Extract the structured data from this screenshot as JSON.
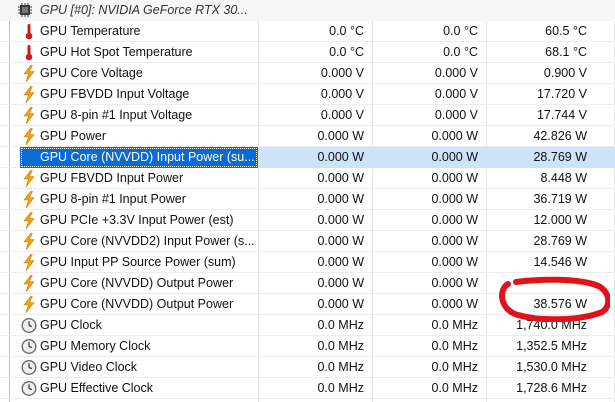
{
  "group": {
    "label": "GPU [#0]: NVIDIA GeForce RTX 30...",
    "icon": "gpu-chip-icon"
  },
  "rows": [
    {
      "name": "GPU Temperature",
      "v1": "0.0 °C",
      "v2": "0.0 °C",
      "v3": "60.5 °C",
      "icon": "thermometer-icon"
    },
    {
      "name": "GPU Hot Spot Temperature",
      "v1": "0.0 °C",
      "v2": "0.0 °C",
      "v3": "68.1 °C",
      "icon": "thermometer-icon"
    },
    {
      "name": "GPU Core Voltage",
      "v1": "0.000 V",
      "v2": "0.000 V",
      "v3": "0.900 V",
      "icon": "lightning-icon"
    },
    {
      "name": "GPU FBVDD Input Voltage",
      "v1": "0.000 V",
      "v2": "0.000 V",
      "v3": "17.720 V",
      "icon": "lightning-icon"
    },
    {
      "name": "GPU 8-pin #1 Input Voltage",
      "v1": "0.000 V",
      "v2": "0.000 V",
      "v3": "17.744 V",
      "icon": "lightning-icon"
    },
    {
      "name": "GPU Power",
      "v1": "0.000 W",
      "v2": "0.000 W",
      "v3": "42.826 W",
      "icon": "lightning-icon"
    },
    {
      "name": "GPU Core (NVVDD) Input Power (su...",
      "v1": "0.000 W",
      "v2": "0.000 W",
      "v3": "28.769 W",
      "icon": "lightning-icon",
      "selected": true
    },
    {
      "name": "GPU FBVDD Input Power",
      "v1": "0.000 W",
      "v2": "0.000 W",
      "v3": "8.448 W",
      "icon": "lightning-icon"
    },
    {
      "name": "GPU 8-pin #1 Input Power",
      "v1": "0.000 W",
      "v2": "0.000 W",
      "v3": "36.719 W",
      "icon": "lightning-icon"
    },
    {
      "name": "GPU PCIe +3.3V Input Power (est)",
      "v1": "0.000 W",
      "v2": "0.000 W",
      "v3": "12.000 W",
      "icon": "lightning-icon"
    },
    {
      "name": "GPU Core (NVVDD2) Input Power (s...",
      "v1": "0.000 W",
      "v2": "0.000 W",
      "v3": "28.769 W",
      "icon": "lightning-icon"
    },
    {
      "name": "GPU Input PP Source Power (sum)",
      "v1": "0.000 W",
      "v2": "0.000 W",
      "v3": "14.546 W",
      "icon": "lightning-icon"
    },
    {
      "name": "GPU Core (NVVDD) Output Power",
      "v1": "0.000 W",
      "v2": "0.000 W",
      "v3": "",
      "icon": "lightning-icon"
    },
    {
      "name": "GPU Core (NVVDD) Output Power",
      "v1": "0.000 W",
      "v2": "0.000 W",
      "v3": "38.576 W",
      "icon": "lightning-icon"
    },
    {
      "name": "GPU Clock",
      "v1": "0.0 MHz",
      "v2": "0.0 MHz",
      "v3": "1,740.0 MHz",
      "icon": "clock-icon"
    },
    {
      "name": "GPU Memory Clock",
      "v1": "0.0 MHz",
      "v2": "0.0 MHz",
      "v3": "1,352.5 MHz",
      "icon": "clock-icon"
    },
    {
      "name": "GPU Video Clock",
      "v1": "0.0 MHz",
      "v2": "0.0 MHz",
      "v3": "1,530.0 MHz",
      "icon": "clock-icon"
    },
    {
      "name": "GPU Effective Clock",
      "v1": "0.0 MHz",
      "v2": "0.0 MHz",
      "v3": "1,728.6 MHz",
      "icon": "clock-icon"
    }
  ],
  "colors": {
    "selection": "#0a6ad6",
    "annotation": "#e0121b",
    "lightning": "#f0a317",
    "thermometer": "#c81e1e"
  }
}
